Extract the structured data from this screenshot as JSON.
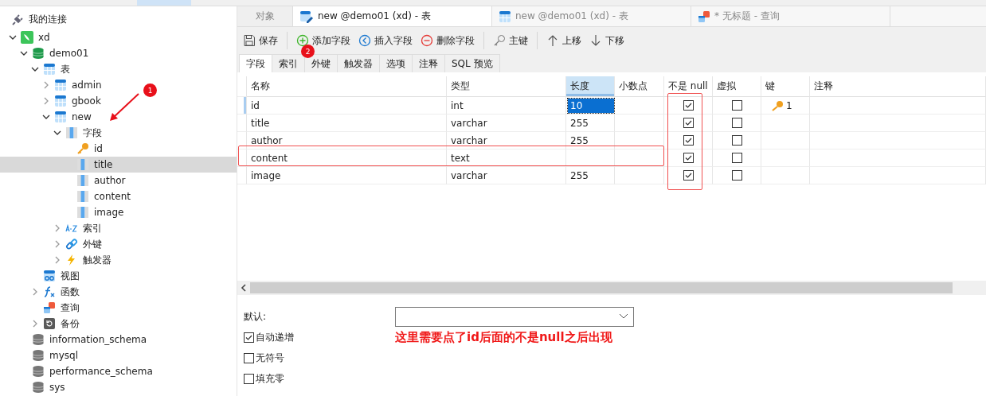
{
  "sidebar": {
    "header": "我的连接",
    "tree": [
      {
        "label": "xd",
        "kind": "connection",
        "expanded": true,
        "selected": false,
        "children": [
          {
            "label": "demo01",
            "kind": "database",
            "expanded": true,
            "selected": false,
            "children": [
              {
                "label": "表",
                "kind": "tables",
                "expanded": true,
                "selected": false,
                "children": [
                  {
                    "label": "admin",
                    "kind": "table",
                    "expanded": false,
                    "selected": false
                  },
                  {
                    "label": "gbook",
                    "kind": "table",
                    "expanded": false,
                    "selected": false
                  },
                  {
                    "label": "new",
                    "kind": "table",
                    "expanded": true,
                    "selected": false,
                    "children": [
                      {
                        "label": "字段",
                        "kind": "fields",
                        "expanded": true,
                        "selected": false,
                        "children": [
                          {
                            "label": "id",
                            "kind": "key",
                            "selected": false
                          },
                          {
                            "label": "title",
                            "kind": "field",
                            "selected": true
                          },
                          {
                            "label": "author",
                            "kind": "field",
                            "selected": false
                          },
                          {
                            "label": "content",
                            "kind": "field",
                            "selected": false
                          },
                          {
                            "label": "image",
                            "kind": "field",
                            "selected": false
                          }
                        ]
                      },
                      {
                        "label": "索引",
                        "kind": "index",
                        "expanded": false,
                        "selected": false
                      },
                      {
                        "label": "外键",
                        "kind": "foreign",
                        "expanded": false,
                        "selected": false
                      },
                      {
                        "label": "触发器",
                        "kind": "trigger",
                        "expanded": false,
                        "selected": false
                      }
                    ]
                  }
                ]
              },
              {
                "label": "视图",
                "kind": "view",
                "selected": false
              },
              {
                "label": "函数",
                "kind": "function",
                "expanded": false,
                "selected": false
              },
              {
                "label": "查询",
                "kind": "query",
                "selected": false
              },
              {
                "label": "备份",
                "kind": "backup",
                "expanded": false,
                "selected": false
              }
            ]
          },
          {
            "label": "information_schema",
            "kind": "db-grey",
            "selected": false
          },
          {
            "label": "mysql",
            "kind": "db-grey",
            "selected": false
          },
          {
            "label": "performance_schema",
            "kind": "db-grey",
            "selected": false
          },
          {
            "label": "sys",
            "kind": "db-grey",
            "selected": false
          }
        ]
      }
    ]
  },
  "tabs": [
    {
      "label": "对象",
      "kind": "plain",
      "selected": false
    },
    {
      "label": "new @demo01 (xd) - 表",
      "kind": "design",
      "selected": true
    },
    {
      "label": "new @demo01 (xd) - 表",
      "kind": "table",
      "selected": false
    },
    {
      "label": "* 无标题 - 查询",
      "kind": "query",
      "selected": false
    }
  ],
  "toolbar": [
    {
      "label": "保存",
      "kind": "save"
    },
    {
      "kind": "separator"
    },
    {
      "label": "添加字段",
      "kind": "add"
    },
    {
      "label": "插入字段",
      "kind": "insert"
    },
    {
      "label": "删除字段",
      "kind": "delete"
    },
    {
      "kind": "separator"
    },
    {
      "label": "主键",
      "kind": "key"
    },
    {
      "kind": "separator"
    },
    {
      "label": "上移",
      "kind": "up"
    },
    {
      "label": "下移",
      "kind": "down"
    }
  ],
  "subtabs": [
    {
      "label": "字段",
      "selected": true
    },
    {
      "label": "索引",
      "selected": false
    },
    {
      "label": "外键",
      "selected": false
    },
    {
      "label": "触发器",
      "selected": false
    },
    {
      "label": "选项",
      "selected": false
    },
    {
      "label": "注释",
      "selected": false
    },
    {
      "label": "SQL 预览",
      "selected": false
    }
  ],
  "table": {
    "columns": [
      {
        "label": "名称",
        "selected": false
      },
      {
        "label": "类型",
        "selected": false
      },
      {
        "label": "长度",
        "selected": true
      },
      {
        "label": "小数点",
        "selected": false
      },
      {
        "label": "不是 null",
        "selected": false
      },
      {
        "label": "虚拟",
        "selected": false
      },
      {
        "label": "键",
        "selected": false
      },
      {
        "label": "注释",
        "selected": false
      }
    ],
    "rows": [
      {
        "name": "id",
        "type": "int",
        "length": "10",
        "not_null": true,
        "virtual": false,
        "key": "1",
        "selected": true
      },
      {
        "name": "title",
        "type": "varchar",
        "length": "255",
        "not_null": true,
        "virtual": false,
        "selected": false
      },
      {
        "name": "author",
        "type": "varchar",
        "length": "255",
        "not_null": true,
        "virtual": false,
        "selected": false
      },
      {
        "name": "content",
        "type": "text",
        "not_null": true,
        "virtual": false,
        "selected": false
      },
      {
        "name": "image",
        "type": "varchar",
        "length": "255",
        "not_null": true,
        "virtual": false,
        "selected": false
      }
    ]
  },
  "options": {
    "default_label": "默认:",
    "checks": [
      {
        "label": "自动递增",
        "checked": true
      },
      {
        "label": "无符号",
        "checked": false
      },
      {
        "label": "填充零",
        "checked": false
      }
    ]
  },
  "annotations": {
    "badges": [
      "1",
      "2"
    ],
    "note": "这里需要点了id后面的不是null之后出现"
  }
}
